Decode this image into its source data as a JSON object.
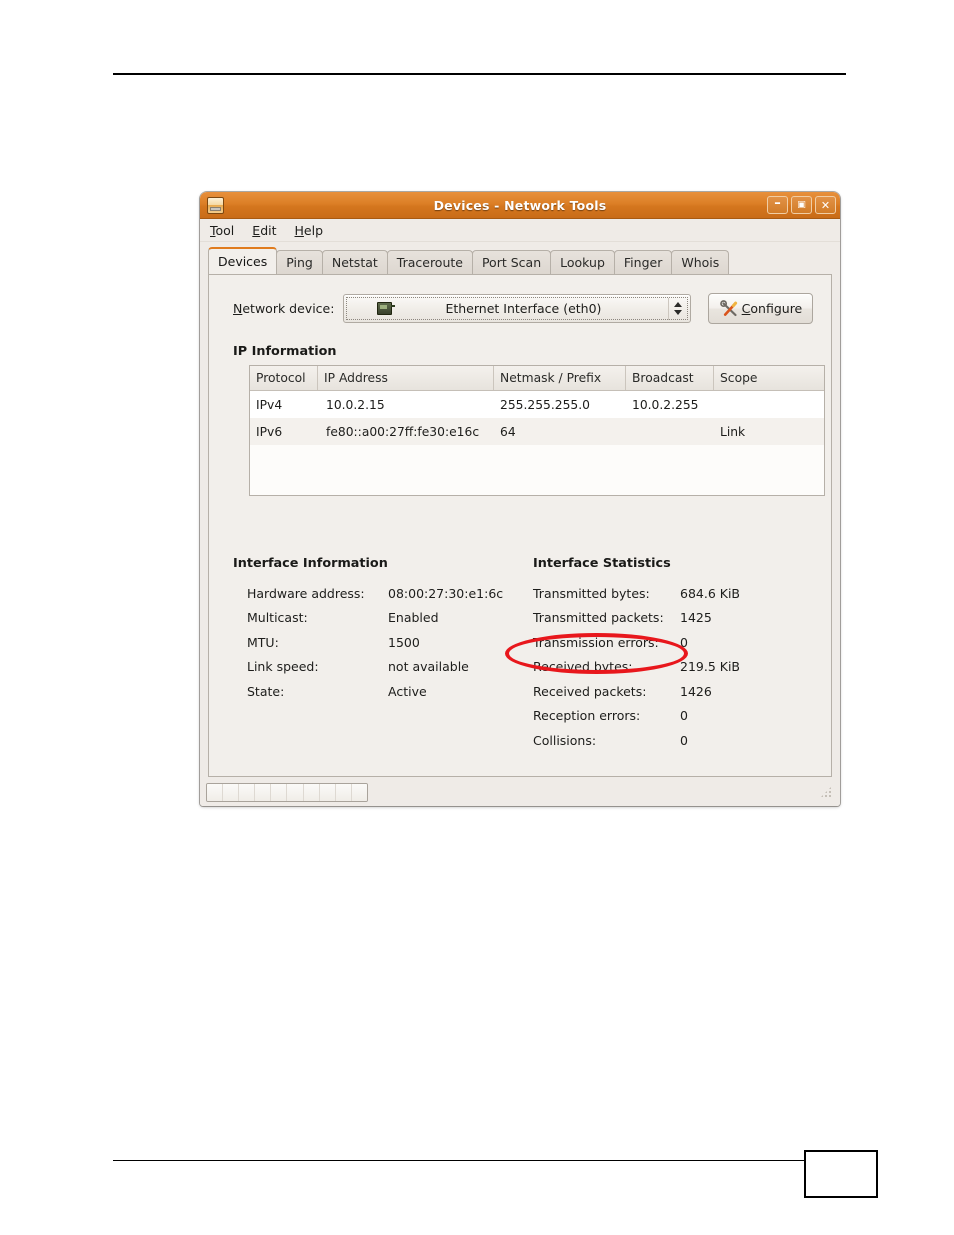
{
  "window": {
    "title": "Devices - Network Tools",
    "icon": "network-tools-icon",
    "buttons": {
      "minimize": "–",
      "maximize": "▣",
      "close": "✕"
    }
  },
  "menubar": {
    "items": [
      {
        "label": "Tool",
        "mnemonic": "T"
      },
      {
        "label": "Edit",
        "mnemonic": "E"
      },
      {
        "label": "Help",
        "mnemonic": "H"
      }
    ]
  },
  "tabs": [
    {
      "label": "Devices",
      "active": true
    },
    {
      "label": "Ping",
      "active": false
    },
    {
      "label": "Netstat",
      "active": false
    },
    {
      "label": "Traceroute",
      "active": false
    },
    {
      "label": "Port Scan",
      "active": false
    },
    {
      "label": "Lookup",
      "active": false
    },
    {
      "label": "Finger",
      "active": false
    },
    {
      "label": "Whois",
      "active": false
    }
  ],
  "device_row": {
    "label": "Network device:",
    "label_mnemonic": "N",
    "selected_device": "Ethernet Interface (eth0)",
    "configure_label": "Configure",
    "configure_mnemonic": "C"
  },
  "ip_information": {
    "heading": "IP Information",
    "columns": [
      "Protocol",
      "IP Address",
      "Netmask / Prefix",
      "Broadcast",
      "Scope"
    ],
    "rows": [
      {
        "protocol": "IPv4",
        "address": "10.0.2.15",
        "netmask": "255.255.255.0",
        "broadcast": "10.0.2.255",
        "scope": ""
      },
      {
        "protocol": "IPv6",
        "address": "fe80::a00:27ff:fe30:e16c",
        "netmask": "64",
        "broadcast": "",
        "scope": "Link"
      }
    ]
  },
  "interface_information": {
    "heading": "Interface Information",
    "rows": [
      {
        "key": "Hardware address:",
        "value": "08:00:27:30:e1:6c"
      },
      {
        "key": "Multicast:",
        "value": "Enabled"
      },
      {
        "key": "MTU:",
        "value": "1500"
      },
      {
        "key": "Link speed:",
        "value": "not available"
      },
      {
        "key": "State:",
        "value": "Active"
      }
    ]
  },
  "interface_statistics": {
    "heading": "Interface Statistics",
    "highlighted": true,
    "rows": [
      {
        "key": "Transmitted bytes:",
        "value": "684.6 KiB"
      },
      {
        "key": "Transmitted packets:",
        "value": "1425"
      },
      {
        "key": "Transmission errors:",
        "value": "0"
      },
      {
        "key": "Received bytes:",
        "value": "219.5 KiB"
      },
      {
        "key": "Received packets:",
        "value": "1426"
      },
      {
        "key": "Reception errors:",
        "value": "0"
      },
      {
        "key": "Collisions:",
        "value": "0"
      }
    ]
  },
  "statusbar": {
    "message": ""
  },
  "page": {
    "number": ""
  },
  "colors": {
    "titlebar": "#dc7f26",
    "tab_active_accent": "#e07b1e",
    "annotation": "#e8171c",
    "window_background": "#efebe7",
    "panel_background": "#f2efeb"
  }
}
